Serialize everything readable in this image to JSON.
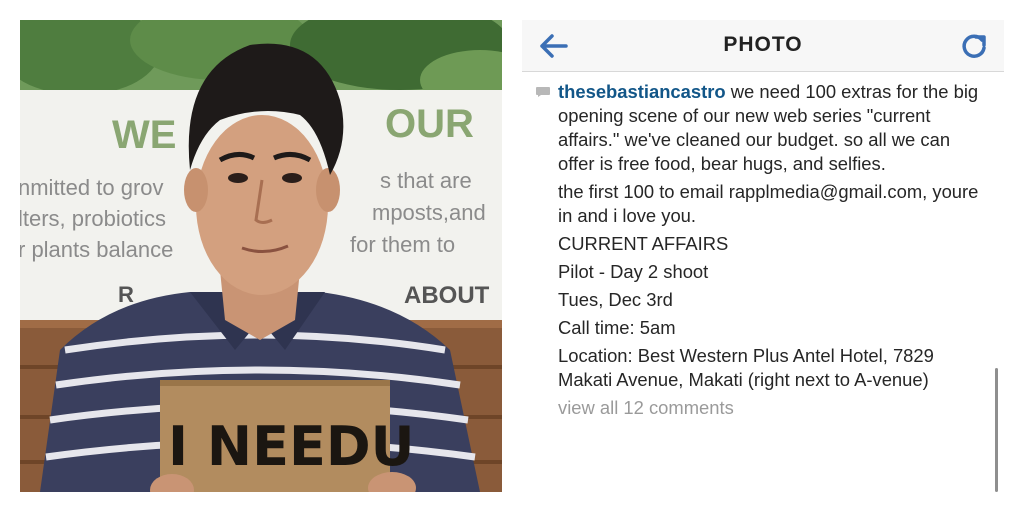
{
  "photo": {
    "poster_line1": "WE",
    "poster_line1_right": "OUR",
    "poster_text_left": [
      "nmitted to grov",
      "lters, probiotics",
      "r plants balance"
    ],
    "poster_text_right": [
      "s that are",
      "mposts,and",
      "for them to"
    ],
    "poster_bottom_left": "R",
    "poster_bottom_right": "ABOUT",
    "sign_text": "I NEEDU"
  },
  "header": {
    "title": "PHOTO",
    "back_icon": "left-arrow-icon",
    "refresh_icon": "refresh-icon",
    "accent_color": "#3b6fb5"
  },
  "post": {
    "username": "thesebastiancastro",
    "caption_first": " we need 100 extras for the big opening scene of our new web series \"current affairs.\" we've cleaned our budget.  so all we can offer is free food, bear hugs, and selfies.",
    "lines": [
      "the first 100 to email rapplmedia@gmail.com, youre in and i love you.",
      "CURRENT AFFAIRS",
      "Pilot - Day 2 shoot",
      "Tues, Dec 3rd",
      "Call time: 5am",
      "Location: Best Western Plus Antel Hotel, 7829 Makati Avenue, Makati (right next to A-venue)"
    ],
    "view_comments": "view all 12 comments"
  }
}
